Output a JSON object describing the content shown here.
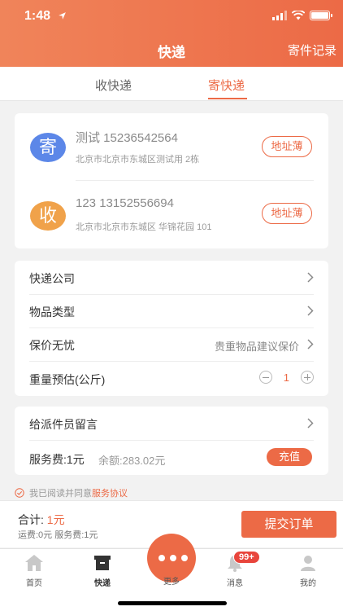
{
  "status": {
    "time": "1:48"
  },
  "nav": {
    "title": "快递",
    "right": "寄件记录"
  },
  "tabs": [
    {
      "label": "收快递"
    },
    {
      "label": "寄快递"
    }
  ],
  "sender": {
    "badge": "寄",
    "name": "测试 15236542564",
    "address": "北京市北京市东城区测试用 2栋",
    "button": "地址薄",
    "color": "#5c87e8"
  },
  "receiver": {
    "badge": "收",
    "name": "123 13152556694",
    "address": "北京市北京市东城区 华锦花园 101",
    "button": "地址薄",
    "color": "#f0a24a"
  },
  "options": {
    "company": "快递公司",
    "item_type": "物品类型",
    "insurance": "保价无忧",
    "insurance_hint": "贵重物品建议保价",
    "weight": "重量预估(公斤)",
    "weight_value": "1"
  },
  "message": {
    "label": "给派件员留言",
    "fee": "服务费:1元",
    "balance": "余额:283.02元",
    "recharge": "充值"
  },
  "agreement": {
    "text": "我已阅读并同意",
    "link": "服务协议"
  },
  "order": {
    "total_label": "合计:",
    "total_amount": "1元",
    "sub_fees": "运费:0元 服务费:1元",
    "submit": "提交订单"
  },
  "tabbar": {
    "items": [
      {
        "label": "首页",
        "icon": "home-icon"
      },
      {
        "label": "快递",
        "icon": "box-icon"
      },
      {
        "label": "更多",
        "icon": "more-icon"
      },
      {
        "label": "消息",
        "icon": "bell-icon"
      },
      {
        "label": "我的",
        "icon": "user-icon"
      }
    ],
    "badge": "99+"
  },
  "colors": {
    "accent": "#ec6a46"
  }
}
